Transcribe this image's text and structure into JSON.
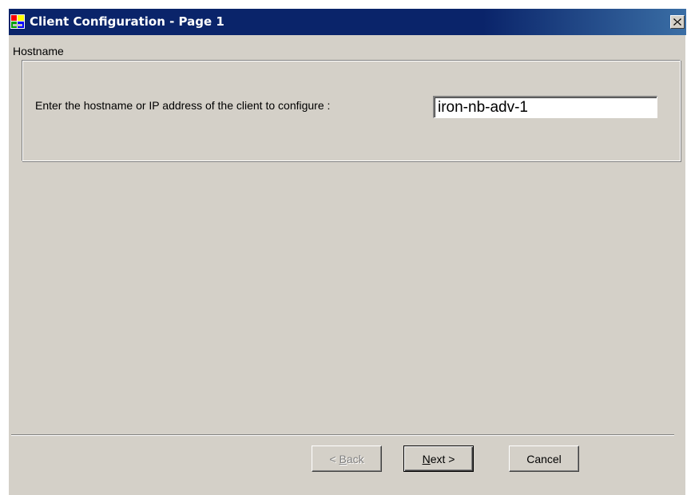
{
  "window": {
    "title": "Client Configuration - Page 1",
    "icon": "app-window-icon",
    "close_icon": "close-icon"
  },
  "hostname_group": {
    "legend": "Hostname",
    "prompt": "Enter the hostname or IP address of the client to configure :",
    "input_value": "iron-nb-adv-1"
  },
  "buttons": {
    "back": {
      "prefix": "< ",
      "accel": "B",
      "rest": "ack",
      "enabled": false
    },
    "next": {
      "accel": "N",
      "rest": "ext >",
      "enabled": true,
      "default": true
    },
    "cancel": {
      "label": "Cancel",
      "enabled": true
    }
  },
  "colors": {
    "titlebar": "#0a246a",
    "face": "#d4d0c8"
  }
}
